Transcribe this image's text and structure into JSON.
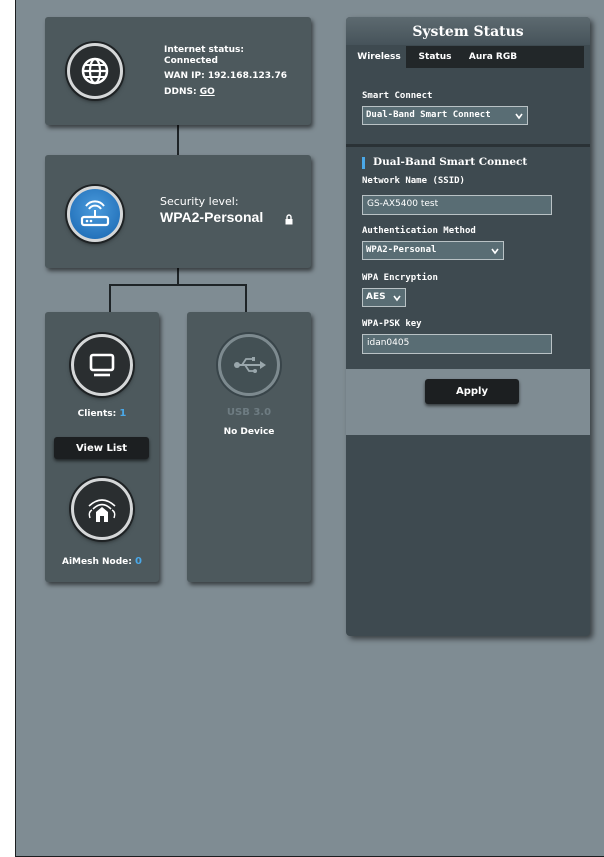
{
  "internet": {
    "status_label": "Internet status:",
    "status_value": "Connected",
    "wan_label": "WAN IP:",
    "wan_ip": "192.168.123.76",
    "ddns_label": "DDNS:",
    "ddns_link": "GO",
    "icon": "globe-icon"
  },
  "security": {
    "label": "Security level:",
    "value": "WPA2-Personal",
    "icon": "router-icon",
    "lock_icon": "lock-icon"
  },
  "clients": {
    "label": "Clients:",
    "count": "1",
    "view_list": "View List",
    "icon": "monitor-icon"
  },
  "aimesh": {
    "label": "AiMesh Node:",
    "count": "0",
    "icon": "aimesh-house-icon"
  },
  "usb": {
    "label": "USB 3.0",
    "status": "No Device",
    "icon": "usb-icon"
  },
  "system_status": {
    "title": "System Status",
    "tabs": [
      {
        "label": "Wireless",
        "active": true
      },
      {
        "label": "Status",
        "active": false
      },
      {
        "label": "Aura RGB",
        "active": false
      }
    ],
    "smart_connect_label": "Smart Connect",
    "smart_connect_value": "Dual-Band Smart Connect",
    "section_title": "Dual-Band Smart Connect",
    "ssid_label": "Network Name (SSID)",
    "ssid_value": "GS-AX5400 test",
    "auth_label": "Authentication Method",
    "auth_value": "WPA2-Personal",
    "enc_label": "WPA Encryption",
    "enc_value": "AES",
    "psk_label": "WPA-PSK key",
    "psk_value": "idan0405",
    "apply": "Apply"
  },
  "colors": {
    "background": "#7f8c93",
    "card": "#4d595d",
    "panel": "#3e4a50",
    "accent_blue": "#4aa8e8",
    "field": "#596d74"
  }
}
